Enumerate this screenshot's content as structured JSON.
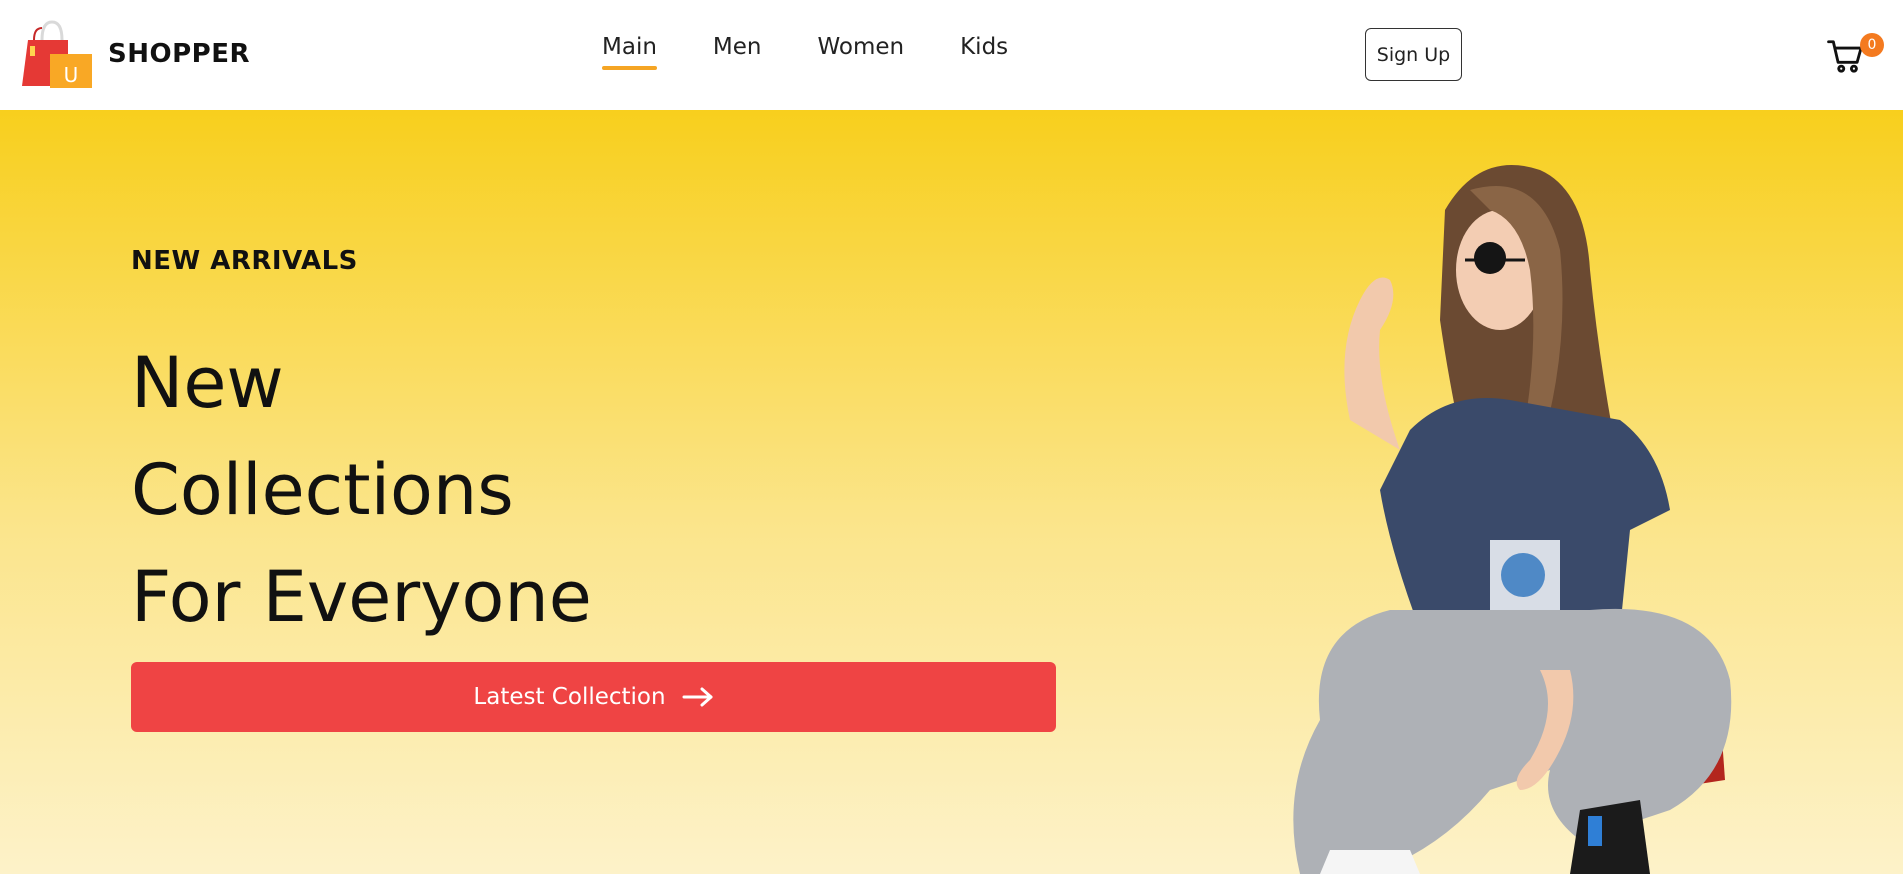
{
  "brand": {
    "name": "SHOPPER",
    "logo_letter": "U",
    "icon": "shopping-bag-icon"
  },
  "nav": {
    "items": [
      {
        "label": "Main",
        "active": true
      },
      {
        "label": "Men",
        "active": false
      },
      {
        "label": "Women",
        "active": false
      },
      {
        "label": "Kids",
        "active": false
      }
    ]
  },
  "header": {
    "signup_label": "Sign Up",
    "cart_icon": "cart-icon",
    "cart_count": "0"
  },
  "hero": {
    "kicker": "NEW ARRIVALS",
    "headline": [
      "New",
      "Collections",
      "For Everyone"
    ],
    "cta_label": "Latest Collection",
    "cta_icon": "arrow-right-icon",
    "image": "fashion-model-photo"
  },
  "colors": {
    "accent": "#f5a524",
    "cta": "#ef4444",
    "badge": "#f47a1f",
    "hero_top": "#f8cf1d",
    "hero_bottom": "#fdf2c9"
  }
}
